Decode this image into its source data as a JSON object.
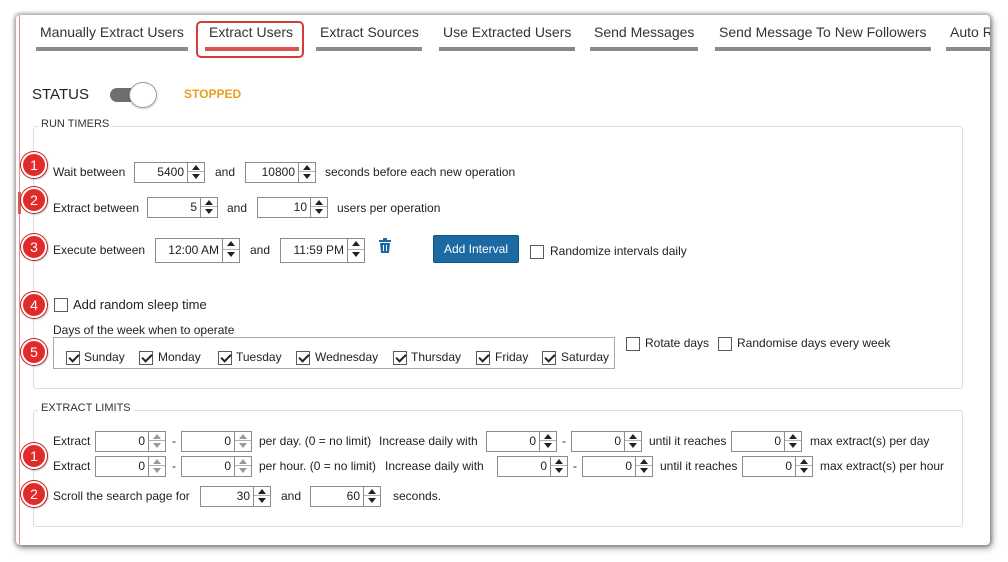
{
  "tabs": [
    {
      "label": "Manually Extract Users"
    },
    {
      "label": "Extract Users"
    },
    {
      "label": "Extract Sources"
    },
    {
      "label": "Use Extracted Users"
    },
    {
      "label": "Send Messages"
    },
    {
      "label": "Send Message To New Followers"
    },
    {
      "label": "Auto R"
    }
  ],
  "status": {
    "label": "STATUS",
    "value": "STOPPED",
    "value_color": "#e8a020"
  },
  "run_timers": {
    "title": "RUN TIMERS",
    "wait": {
      "label": "Wait between",
      "min": "5400",
      "and": "and",
      "max": "10800",
      "suffix": "seconds before each new operation"
    },
    "extract": {
      "label": "Extract between",
      "min": "5",
      "and": "and",
      "max": "10",
      "suffix": "users per operation"
    },
    "execute": {
      "label": "Execute between",
      "start": "12:00 AM",
      "and": "and",
      "end": "11:59 PM"
    },
    "add_interval_label": "Add Interval",
    "randomize_intervals_label": "Randomize intervals daily",
    "random_sleep_label": "Add random sleep time",
    "days_label": "Days of the week when to operate",
    "days": [
      "Sunday",
      "Monday",
      "Tuesday",
      "Wednesday",
      "Thursday",
      "Friday",
      "Saturday"
    ],
    "rotate_days_label": "Rotate days",
    "randomise_days_label": "Randomise days every week"
  },
  "extract_limits": {
    "title": "EXTRACT LIMITS",
    "day_row": {
      "label": "Extract",
      "min": "0",
      "dash": "-",
      "max": "0",
      "per": "per day. (0 = no limit)",
      "increase": "Increase daily with",
      "inc_min": "0",
      "dash2": "-",
      "inc_max": "0",
      "until": "until it reaches",
      "reach": "0",
      "suffix": "max extract(s) per day"
    },
    "hour_row": {
      "label": "Extract",
      "min": "0",
      "dash": "-",
      "max": "0",
      "per": "per hour. (0 = no limit)",
      "increase": "Increase daily with",
      "inc_min": "0",
      "dash2": "-",
      "inc_max": "0",
      "until": "until it reaches",
      "reach": "0",
      "suffix": "max extract(s) per hour"
    },
    "scroll": {
      "label": "Scroll the search page for",
      "min": "30",
      "and": "and",
      "max": "60",
      "suffix": "seconds."
    }
  },
  "markers": [
    "1",
    "2",
    "3",
    "4",
    "5",
    "1",
    "2"
  ],
  "colors": {
    "accent": "#1c6aa3",
    "marker": "#e12a2a",
    "active_tab": "#d9534f"
  }
}
